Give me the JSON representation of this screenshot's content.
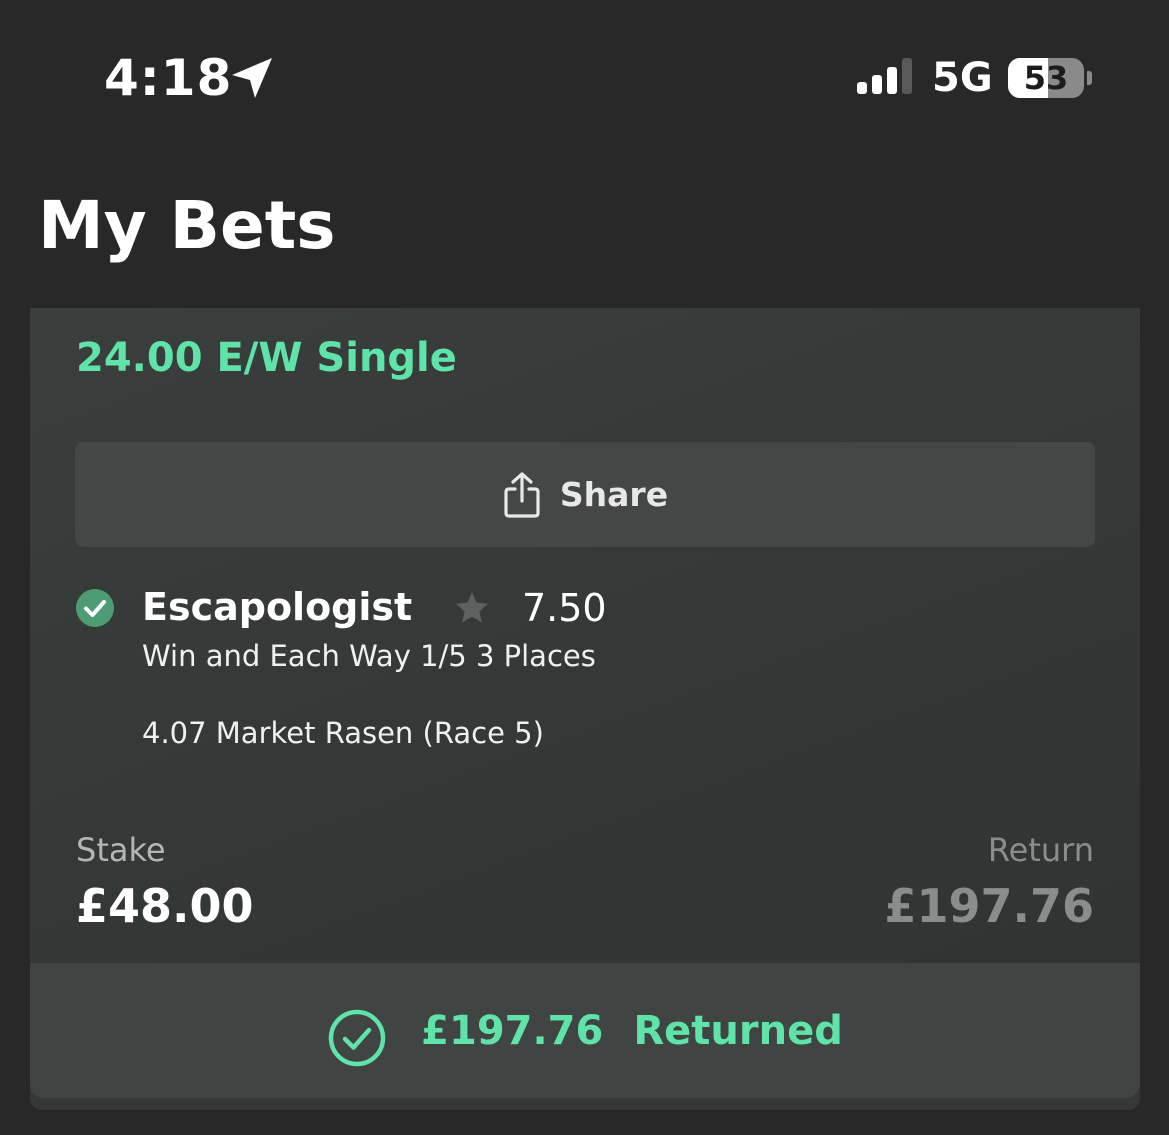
{
  "status_bar": {
    "time": "4:18",
    "location_icon": "location-arrow-icon",
    "signal_icon": "cellular-signal-icon",
    "signal_bars_active": 3,
    "signal_bars_total": 4,
    "network": "5G",
    "battery_icon": "battery-icon",
    "battery_level": "53",
    "battery_fraction": 0.53
  },
  "page": {
    "title": "My Bets"
  },
  "bet": {
    "type_label": "24.00 E/W Single",
    "share_label": "Share",
    "share_icon": "share-icon",
    "selection": {
      "status_icon": "check-circle-icon",
      "name": "Escapologist",
      "favourite_icon": "star-icon",
      "odds": "7.50",
      "market": "Win and Each Way 1/5 3 Places",
      "event": "4.07 Market Rasen (Race 5)"
    },
    "stake_label": "Stake",
    "stake_value": "£48.00",
    "return_label": "Return",
    "return_value": "£197.76",
    "result": {
      "icon": "check-circle-outline-icon",
      "amount": "£197.76",
      "status": "Returned"
    }
  },
  "colors": {
    "background": "#282828",
    "card": "#353937",
    "accent_green": "#5fe3a8",
    "check_green": "#4e9c76",
    "muted_text": "#8a8d8c"
  }
}
